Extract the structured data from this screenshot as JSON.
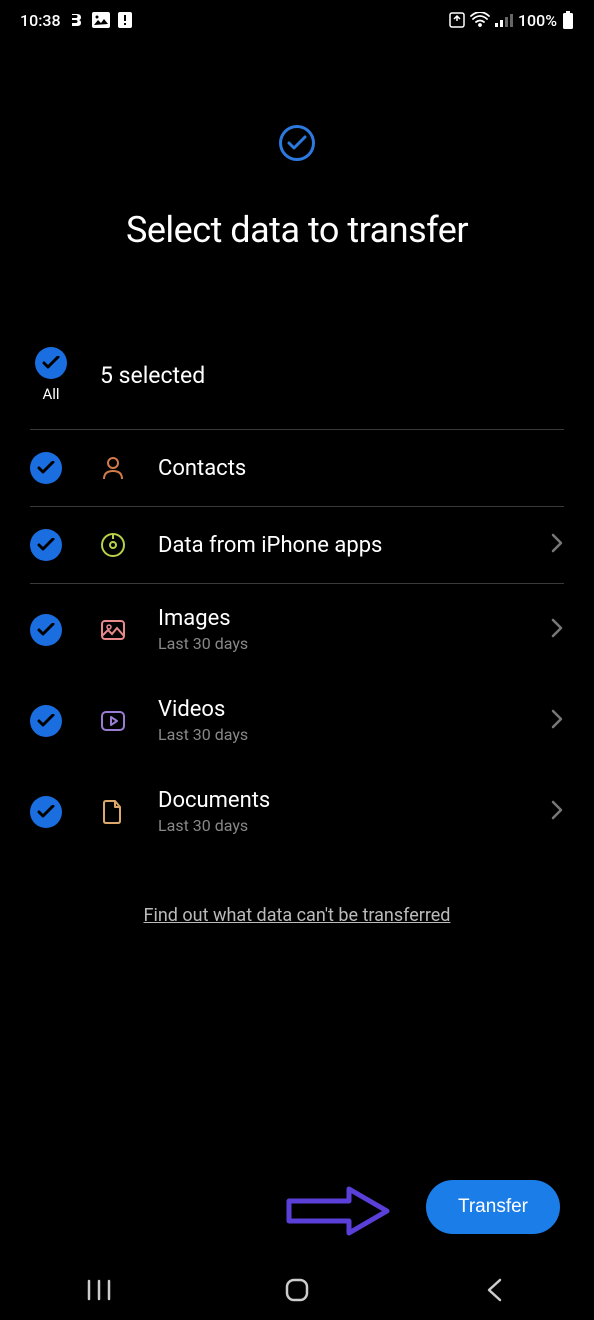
{
  "status": {
    "time": "10:38",
    "battery": "100%"
  },
  "page": {
    "title": "Select data to transfer",
    "all_label": "All",
    "selected_count": "5 selected",
    "info_link": "Find out what data can't be transferred",
    "transfer_button": "Transfer"
  },
  "items": [
    {
      "label": "Contacts",
      "sublabel": "",
      "icon": "contacts",
      "chevron": false,
      "border": true
    },
    {
      "label": "Data from iPhone apps",
      "sublabel": "",
      "icon": "apps",
      "chevron": true,
      "border": true
    },
    {
      "label": "Images",
      "sublabel": "Last 30 days",
      "icon": "images",
      "chevron": true,
      "border": false
    },
    {
      "label": "Videos",
      "sublabel": "Last 30 days",
      "icon": "videos",
      "chevron": true,
      "border": false
    },
    {
      "label": "Documents",
      "sublabel": "Last 30 days",
      "icon": "documents",
      "chevron": true,
      "border": false
    }
  ]
}
